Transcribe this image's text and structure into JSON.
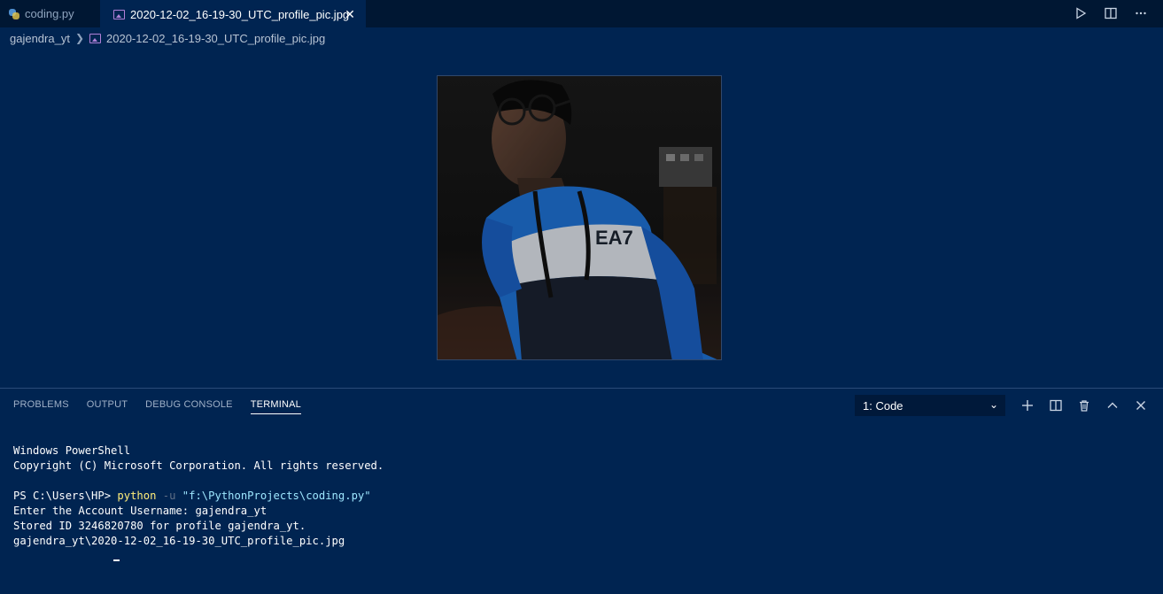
{
  "tabs": [
    {
      "label": "coding.py",
      "icon": "python-file-icon",
      "active": false
    },
    {
      "label": "2020-12-02_16-19-30_UTC_profile_pic.jpg",
      "icon": "image-file-icon",
      "active": true
    }
  ],
  "breadcrumb": {
    "folder": "gajendra_yt",
    "file": "2020-12-02_16-19-30_UTC_profile_pic.jpg"
  },
  "preview": {
    "alt": "profile photo"
  },
  "panel": {
    "tabs": [
      "PROBLEMS",
      "OUTPUT",
      "DEBUG CONSOLE",
      "TERMINAL"
    ],
    "active_tab": "TERMINAL",
    "terminal_select": "1: Code"
  },
  "terminal": {
    "line1": "Windows PowerShell",
    "line2": "Copyright (C) Microsoft Corporation. All rights reserved.",
    "prompt": "PS C:\\Users\\HP> ",
    "cmd": "python",
    "flag": " -u ",
    "arg": "\"f:\\PythonProjects\\coding.py\"",
    "line4": "Enter the Account Username: gajendra_yt",
    "line5": "Stored ID 3246820780 for profile gajendra_yt.",
    "line6": "gajendra_yt\\2020-12-02_16-19-30_UTC_profile_pic.jpg"
  },
  "colors": {
    "background": "#002451",
    "tabbar": "#001733",
    "terminal_command": "#ffee7a",
    "terminal_string": "#9ee7ff"
  }
}
